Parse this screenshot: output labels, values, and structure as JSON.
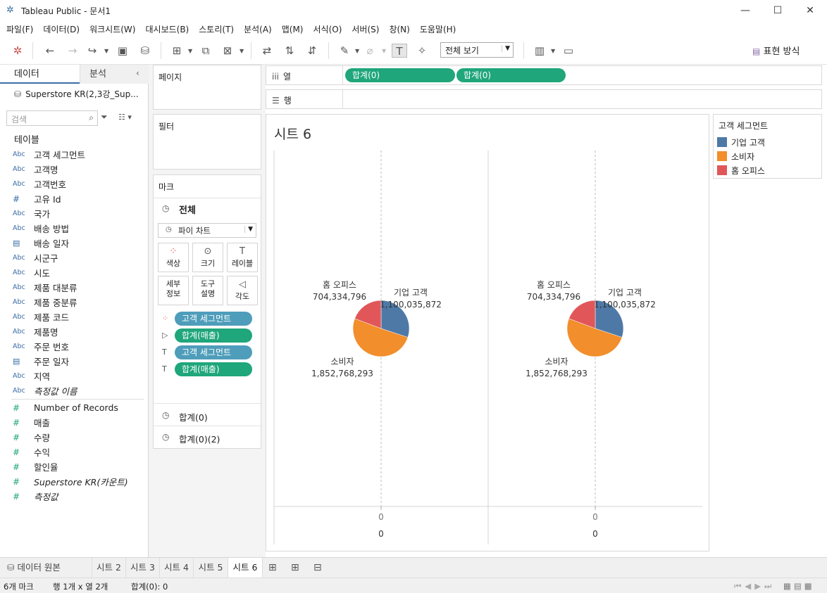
{
  "window": {
    "title": "Tableau Public - 문서1"
  },
  "menu": [
    "파일(F)",
    "데이터(D)",
    "워크시트(W)",
    "대시보드(B)",
    "스토리(T)",
    "분석(A)",
    "맵(M)",
    "서식(O)",
    "서버(S)",
    "창(N)",
    "도움말(H)"
  ],
  "toolbar": {
    "view_select": "전체 보기",
    "show_me": "표현 방식"
  },
  "left": {
    "tab_data": "데이터",
    "tab_analysis": "분석",
    "datasource": "Superstore KR(2,3강_Sup...",
    "search_placeholder": "검색",
    "tables_header": "테이블",
    "dimensions": [
      {
        "type": "Abc",
        "name": "고객 세그먼트"
      },
      {
        "type": "Abc",
        "name": "고객명"
      },
      {
        "type": "Abc",
        "name": "고객번호"
      },
      {
        "type": "#",
        "name": "고유 Id"
      },
      {
        "type": "Abc",
        "name": "국가"
      },
      {
        "type": "Abc",
        "name": "배송 방법"
      },
      {
        "type": "date",
        "name": "배송 일자"
      },
      {
        "type": "Abc",
        "name": "시군구"
      },
      {
        "type": "Abc",
        "name": "시도"
      },
      {
        "type": "Abc",
        "name": "제품 대분류"
      },
      {
        "type": "Abc",
        "name": "제품 중분류"
      },
      {
        "type": "Abc",
        "name": "제품 코드"
      },
      {
        "type": "Abc",
        "name": "제품명"
      },
      {
        "type": "Abc",
        "name": "주문 번호"
      },
      {
        "type": "date",
        "name": "주문 일자"
      },
      {
        "type": "Abc",
        "name": "지역"
      },
      {
        "type": "Abc",
        "name": "측정값 이름",
        "italic": true
      }
    ],
    "measures": [
      {
        "name": "Number of Records"
      },
      {
        "name": "매출"
      },
      {
        "name": "수량"
      },
      {
        "name": "수익"
      },
      {
        "name": "할인율"
      },
      {
        "name": "Superstore KR(카운트)",
        "italic": true
      },
      {
        "name": "측정값",
        "italic": true
      }
    ]
  },
  "shelves": {
    "pages": "페이지",
    "filters": "필터",
    "marks": "마크",
    "marks_all": "전체",
    "mark_type": "파이 차트",
    "buttons": {
      "color": "색상",
      "size": "크기",
      "label": "레이블",
      "detail": "세부\n정보",
      "tooltip": "도구\n설명",
      "angle": "각도"
    },
    "mark_pills": [
      "고객 세그먼트",
      "합계(매출)",
      "고객 세그먼트",
      "합계(매출)"
    ],
    "sub_marks": [
      "합계(0)",
      "합계(0)(2)"
    ],
    "columns_label": "열",
    "rows_label": "행",
    "column_pills": [
      "합계(0)",
      "합계(0)"
    ]
  },
  "view": {
    "sheet_title": "시트 6",
    "axis_tick": "0",
    "axis_title": "0"
  },
  "chart_data": [
    {
      "type": "pie",
      "title": "",
      "categories": [
        "기업 고객",
        "소비자",
        "홈 오피스"
      ],
      "values": [
        1100035872,
        1852768293,
        704334796
      ],
      "labels": [
        "1,100,035,872",
        "1,852,768,293",
        "704,334,796"
      ],
      "colors": [
        "#4e79a7",
        "#f28e2b",
        "#e15759"
      ]
    },
    {
      "type": "pie",
      "title": "",
      "categories": [
        "기업 고객",
        "소비자",
        "홈 오피스"
      ],
      "values": [
        1100035872,
        1852768293,
        704334796
      ],
      "labels": [
        "1,100,035,872",
        "1,852,768,293",
        "704,334,796"
      ],
      "colors": [
        "#4e79a7",
        "#f28e2b",
        "#e15759"
      ]
    }
  ],
  "legend": {
    "title": "고객 세그먼트",
    "items": [
      {
        "name": "기업 고객",
        "color": "#4e79a7"
      },
      {
        "name": "소비자",
        "color": "#f28e2b"
      },
      {
        "name": "홈 오피스",
        "color": "#e15759"
      }
    ]
  },
  "tabs": {
    "datasource": "데이터 원본",
    "sheets": [
      "시트 2",
      "시트 3",
      "시트 4",
      "시트 5",
      "시트 6"
    ],
    "active": "시트 6"
  },
  "status": {
    "marks": "6개 마크",
    "rows_cols": "행 1개 x 열 2개",
    "sum": "합계(0): 0"
  }
}
